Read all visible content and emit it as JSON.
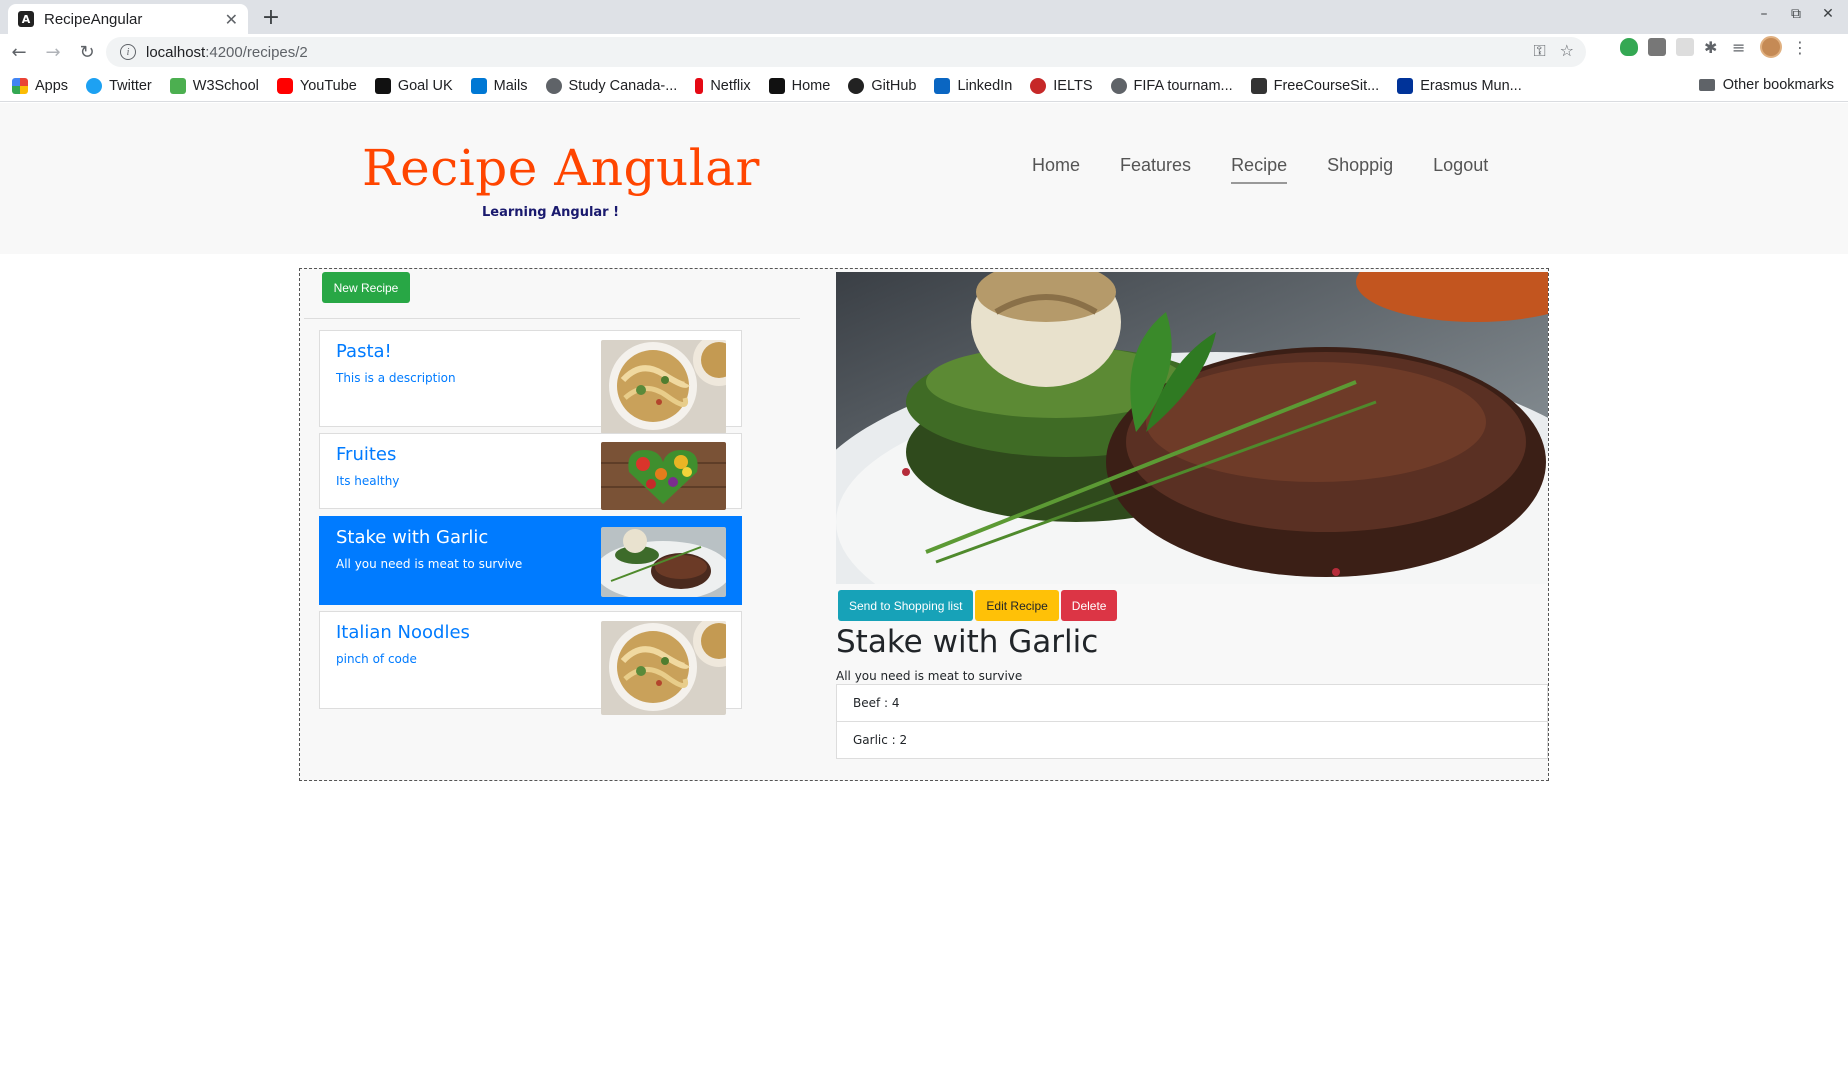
{
  "browser": {
    "tab_title": "RecipeAngular",
    "url_host": "localhost",
    "url_path": ":4200/recipes/2",
    "bookmarks": [
      "Apps",
      "Twitter",
      "W3School",
      "YouTube",
      "Goal UK",
      "Mails",
      "Study Canada-...",
      "Netflix",
      "Home",
      "GitHub",
      "LinkedIn",
      "IELTS",
      "FIFA tournam...",
      "FreeCourseSit...",
      "Erasmus Mun..."
    ],
    "other_bookmarks": "Other bookmarks"
  },
  "header": {
    "brand": "Recipe Angular",
    "tagline": "Learning Angular !",
    "nav": [
      "Home",
      "Features",
      "Recipe",
      "Shoppig",
      "Logout"
    ],
    "active_nav": "Recipe"
  },
  "recipes": {
    "new_button": "New Recipe",
    "items": [
      {
        "name": "Pasta!",
        "description": "This is a description"
      },
      {
        "name": "Fruites",
        "description": "Its healthy"
      },
      {
        "name": "Stake with Garlic",
        "description": "All you need is meat to survive"
      },
      {
        "name": "Italian Noodles",
        "description": "pinch of code"
      }
    ],
    "selected_index": 2
  },
  "detail": {
    "buttons": {
      "send": "Send to Shopping list",
      "edit": "Edit Recipe",
      "delete": "Delete"
    },
    "title": "Stake with Garlic",
    "description": "All you need is meat to survive",
    "ingredients": [
      "Beef : 4",
      "Garlic : 2"
    ]
  },
  "colors": {
    "brand": "#ff4500",
    "primary": "#007bff",
    "success": "#28a745",
    "info": "#17a2b8",
    "warning": "#ffc107",
    "danger": "#dc3545"
  }
}
